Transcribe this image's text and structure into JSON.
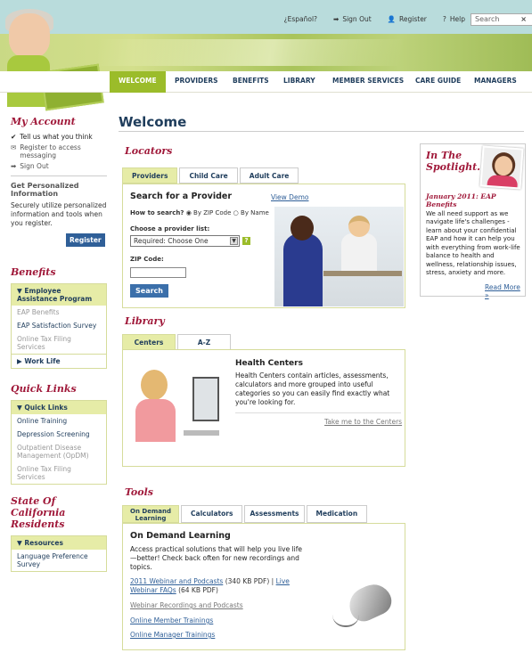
{
  "header": {
    "links": [
      {
        "label": "¿Español?",
        "icon": ""
      },
      {
        "label": "Sign Out",
        "icon": "arrow-right-icon"
      },
      {
        "label": "Register",
        "icon": "person-icon"
      },
      {
        "label": "Help",
        "icon": "question-icon"
      }
    ],
    "search": {
      "placeholder": "Search",
      "clear": "×"
    },
    "welcome_sign": "WELCOME"
  },
  "nav": {
    "items": [
      "WELCOME",
      "PROVIDERS",
      "BENEFITS",
      "LIBRARY",
      "MEMBER SERVICES",
      "CARE GUIDE",
      "MANAGERS"
    ]
  },
  "sidebar": {
    "my_account": {
      "title": "My Account",
      "items": [
        "Tell us what you think",
        "Register to access messaging",
        "Sign Out"
      ]
    },
    "personalized": {
      "title": "Get Personalized Information",
      "text": "Securely utilize personalized information and tools when you register.",
      "button": "Register"
    },
    "benefits": {
      "title": "Benefits",
      "head": "Employee Assistance Program",
      "items": [
        "EAP Benefits",
        "EAP Satisfaction Survey",
        "Online Tax Filing Services"
      ],
      "sub": "Work Life"
    },
    "quick_links": {
      "title": "Quick Links",
      "head": "Quick Links",
      "items": [
        "Online Training",
        "Depression Screening",
        "Outpatient Disease Management (OpDM)",
        "Online Tax Filing Services"
      ]
    },
    "state": {
      "title": "State Of California Residents",
      "head": "Resources",
      "items": [
        "Language Preference Survey"
      ]
    }
  },
  "main": {
    "title": "Welcome",
    "locators": {
      "title": "Locators",
      "tabs": [
        "Providers",
        "Child Care",
        "Adult Care"
      ],
      "search_title": "Search for a Provider",
      "view_demo": "View Demo",
      "how_label": "How to search?",
      "radio1": "By ZIP Code",
      "radio2": "By Name",
      "choose_label": "Choose a provider list:",
      "select_value": "Required: Choose One",
      "help_badge": "?",
      "zip_label": "ZIP Code:",
      "search_button": "Search"
    },
    "library": {
      "title": "Library",
      "tabs": [
        "Centers",
        "A-Z"
      ],
      "heading": "Health Centers",
      "text": "Health Centers contain articles, assessments, calculators and more grouped into useful categories so you can easily find exactly what you're looking for.",
      "link": "Take me to the Centers"
    },
    "tools": {
      "title": "Tools",
      "tabs": [
        "On Demand Learning",
        "Calculators",
        "Assessments",
        "Medication"
      ],
      "heading": "On Demand Learning",
      "text": "Access practical solutions that will help you live life—better! Check back often for new recordings and topics.",
      "link1": "2011 Webinar and Podcasts",
      "link1_note": "(340 KB PDF) |",
      "link2": "Live Webinar FAQs",
      "link2_note": "(64 KB PDF)",
      "link3": "Webinar Recordings and Podcasts",
      "link4": "Online Member Trainings",
      "link5": "Online Manager Trainings"
    }
  },
  "spotlight": {
    "title": "In The Spotlight...",
    "subtitle": "January 2011: EAP Benefits",
    "text": "We all need support as we navigate life's challenges - learn about your confidential EAP and how it can help you with everything from work-life balance to health and wellness, relationship issues, stress, anxiety and more.",
    "read_more": "Read More »"
  }
}
